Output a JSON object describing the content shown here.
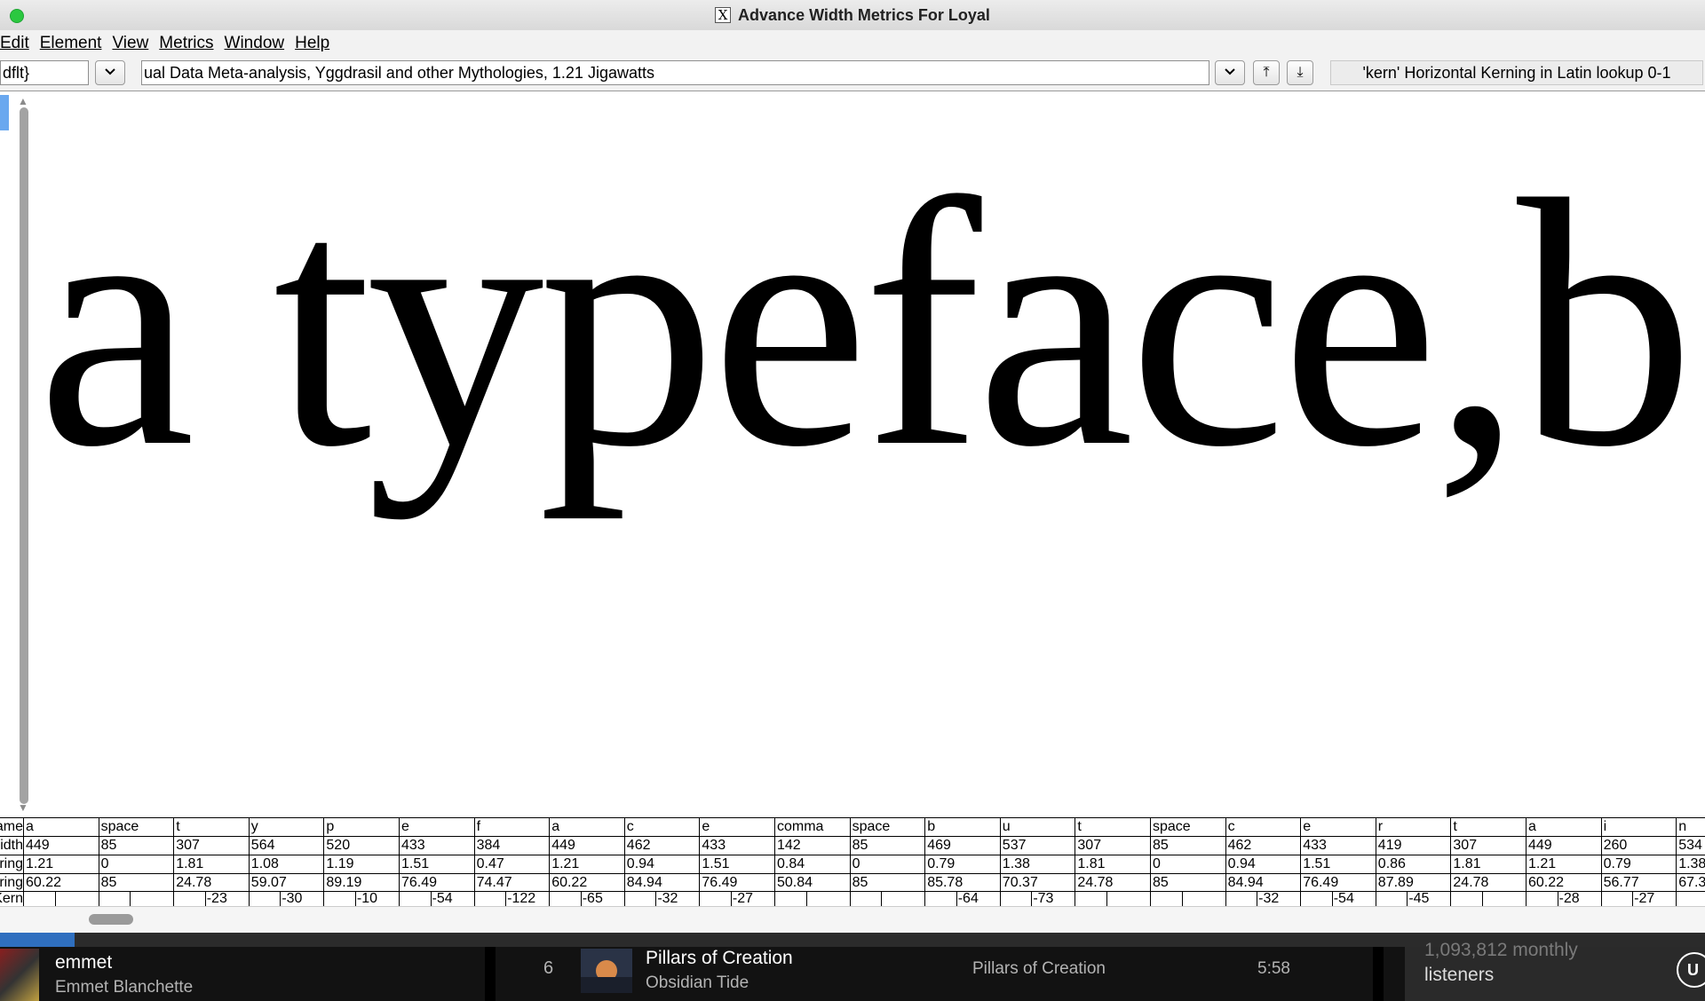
{
  "window": {
    "title": "Advance Width Metrics For Loyal"
  },
  "menu": [
    "Edit",
    "Element",
    "View",
    "Metrics",
    "Window",
    "Help"
  ],
  "toolbar": {
    "script_field": "dflt}",
    "text_field": "ual Data Meta-analysis, Yggdrasil and other Mythologies, 1.21 Jigawatts",
    "up_icon": "⤒",
    "down_icon": "⤓",
    "chevron": "⌄",
    "lookup": "'kern' Horizontal Kerning in Latin lookup 0-1"
  },
  "sample_text": "a typeface,b",
  "metrics": {
    "row_labels": [
      "Name:",
      "Width:",
      "LBearing:",
      "RBearing:",
      "Kern:"
    ],
    "glyphs": [
      {
        "name": "a",
        "width": "449",
        "lbearing": "1.21",
        "rbearing": "60.22",
        "kern": ""
      },
      {
        "name": "space",
        "width": "85",
        "lbearing": "0",
        "rbearing": "85",
        "kern": ""
      },
      {
        "name": "t",
        "width": "307",
        "lbearing": "1.81",
        "rbearing": "24.78",
        "kern": "-23"
      },
      {
        "name": "y",
        "width": "564",
        "lbearing": "1.08",
        "rbearing": "59.07",
        "kern": "-30"
      },
      {
        "name": "p",
        "width": "520",
        "lbearing": "1.19",
        "rbearing": "89.19",
        "kern": "-10"
      },
      {
        "name": "e",
        "width": "433",
        "lbearing": "1.51",
        "rbearing": "76.49",
        "kern": "-54"
      },
      {
        "name": "f",
        "width": "384",
        "lbearing": "0.47",
        "rbearing": "74.47",
        "kern": "-122"
      },
      {
        "name": "a",
        "width": "449",
        "lbearing": "1.21",
        "rbearing": "60.22",
        "kern": "-65"
      },
      {
        "name": "c",
        "width": "462",
        "lbearing": "0.94",
        "rbearing": "84.94",
        "kern": "-32"
      },
      {
        "name": "e",
        "width": "433",
        "lbearing": "1.51",
        "rbearing": "76.49",
        "kern": "-27"
      },
      {
        "name": "comma",
        "width": "142",
        "lbearing": "0.84",
        "rbearing": "50.84",
        "kern": ""
      },
      {
        "name": "space",
        "width": "85",
        "lbearing": "0",
        "rbearing": "85",
        "kern": ""
      },
      {
        "name": "b",
        "width": "469",
        "lbearing": "0.79",
        "rbearing": "85.78",
        "kern": "-64"
      },
      {
        "name": "u",
        "width": "537",
        "lbearing": "1.38",
        "rbearing": "70.37",
        "kern": "-73"
      },
      {
        "name": "t",
        "width": "307",
        "lbearing": "1.81",
        "rbearing": "24.78",
        "kern": ""
      },
      {
        "name": "space",
        "width": "85",
        "lbearing": "0",
        "rbearing": "85",
        "kern": ""
      },
      {
        "name": "c",
        "width": "462",
        "lbearing": "0.94",
        "rbearing": "84.94",
        "kern": "-32"
      },
      {
        "name": "e",
        "width": "433",
        "lbearing": "1.51",
        "rbearing": "76.49",
        "kern": "-54"
      },
      {
        "name": "r",
        "width": "419",
        "lbearing": "0.86",
        "rbearing": "87.89",
        "kern": "-45"
      },
      {
        "name": "t",
        "width": "307",
        "lbearing": "1.81",
        "rbearing": "24.78",
        "kern": ""
      },
      {
        "name": "a",
        "width": "449",
        "lbearing": "1.21",
        "rbearing": "60.22",
        "kern": "-28"
      },
      {
        "name": "i",
        "width": "260",
        "lbearing": "0.79",
        "rbearing": "56.77",
        "kern": "-27"
      },
      {
        "name": "n",
        "width": "534",
        "lbearing": "1.38",
        "rbearing": "67.3",
        "kern": ""
      }
    ]
  },
  "player": {
    "user_name": "emmet",
    "user_fullname": "Emmet Blanchette",
    "track_number": "6",
    "song_title": "Pillars of Creation",
    "song_artist": "Obsidian Tide",
    "album": "Pillars of Creation",
    "duration": "5:58",
    "listeners_count": "1,093,812 monthly",
    "listeners_label": "listeners",
    "side_button": "U"
  }
}
